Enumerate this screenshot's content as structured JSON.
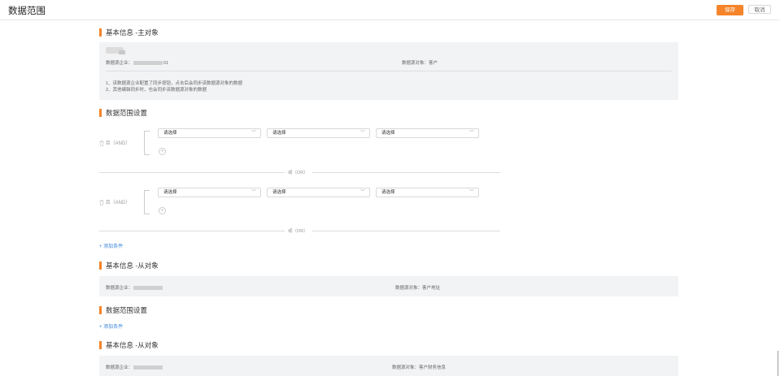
{
  "header": {
    "title": "数据范围",
    "save_label": "保存",
    "cancel_label": "取消"
  },
  "main_object": {
    "title": "基本信息 -主对象",
    "enterprise_label": "数据源企业：",
    "enterprise_value_suffix": "01",
    "object_label": "数据源对象：",
    "object_value": "客户",
    "notes": [
      "1、该数据源企业配置了同步按钮，点击后会同步该数据源对象的数据",
      "2、其他编辑同步时，也会同步该数据源对象的数据"
    ]
  },
  "range_settings": {
    "title": "数据范围设置",
    "groups": [
      {
        "and_label": "且（AND）",
        "selects": [
          "请选择",
          "请选择",
          "请选择"
        ]
      },
      {
        "and_label": "且（AND）",
        "selects": [
          "请选择",
          "请选择",
          "请选择"
        ]
      }
    ],
    "or_label": "或（OR）",
    "add_condition": "+ 添加条件"
  },
  "sub_object_1": {
    "title": "基本信息 -从对象",
    "enterprise_label": "数据源企业：",
    "object_label": "数据源对象：",
    "object_value": "客户地址"
  },
  "range_settings_2": {
    "title": "数据范围设置",
    "add_condition": "+ 添加条件"
  },
  "sub_object_2": {
    "title": "基本信息 -从对象",
    "enterprise_label": "数据源企业：",
    "object_label": "数据源对象：",
    "object_value": "客户财务信息"
  },
  "icons": {
    "trash": "trash-icon",
    "chevron": "chevron-down-icon",
    "plus": "plus-icon"
  },
  "colors": {
    "accent": "#f5842a",
    "link": "#3b86d8",
    "panel": "#f2f3f5"
  }
}
